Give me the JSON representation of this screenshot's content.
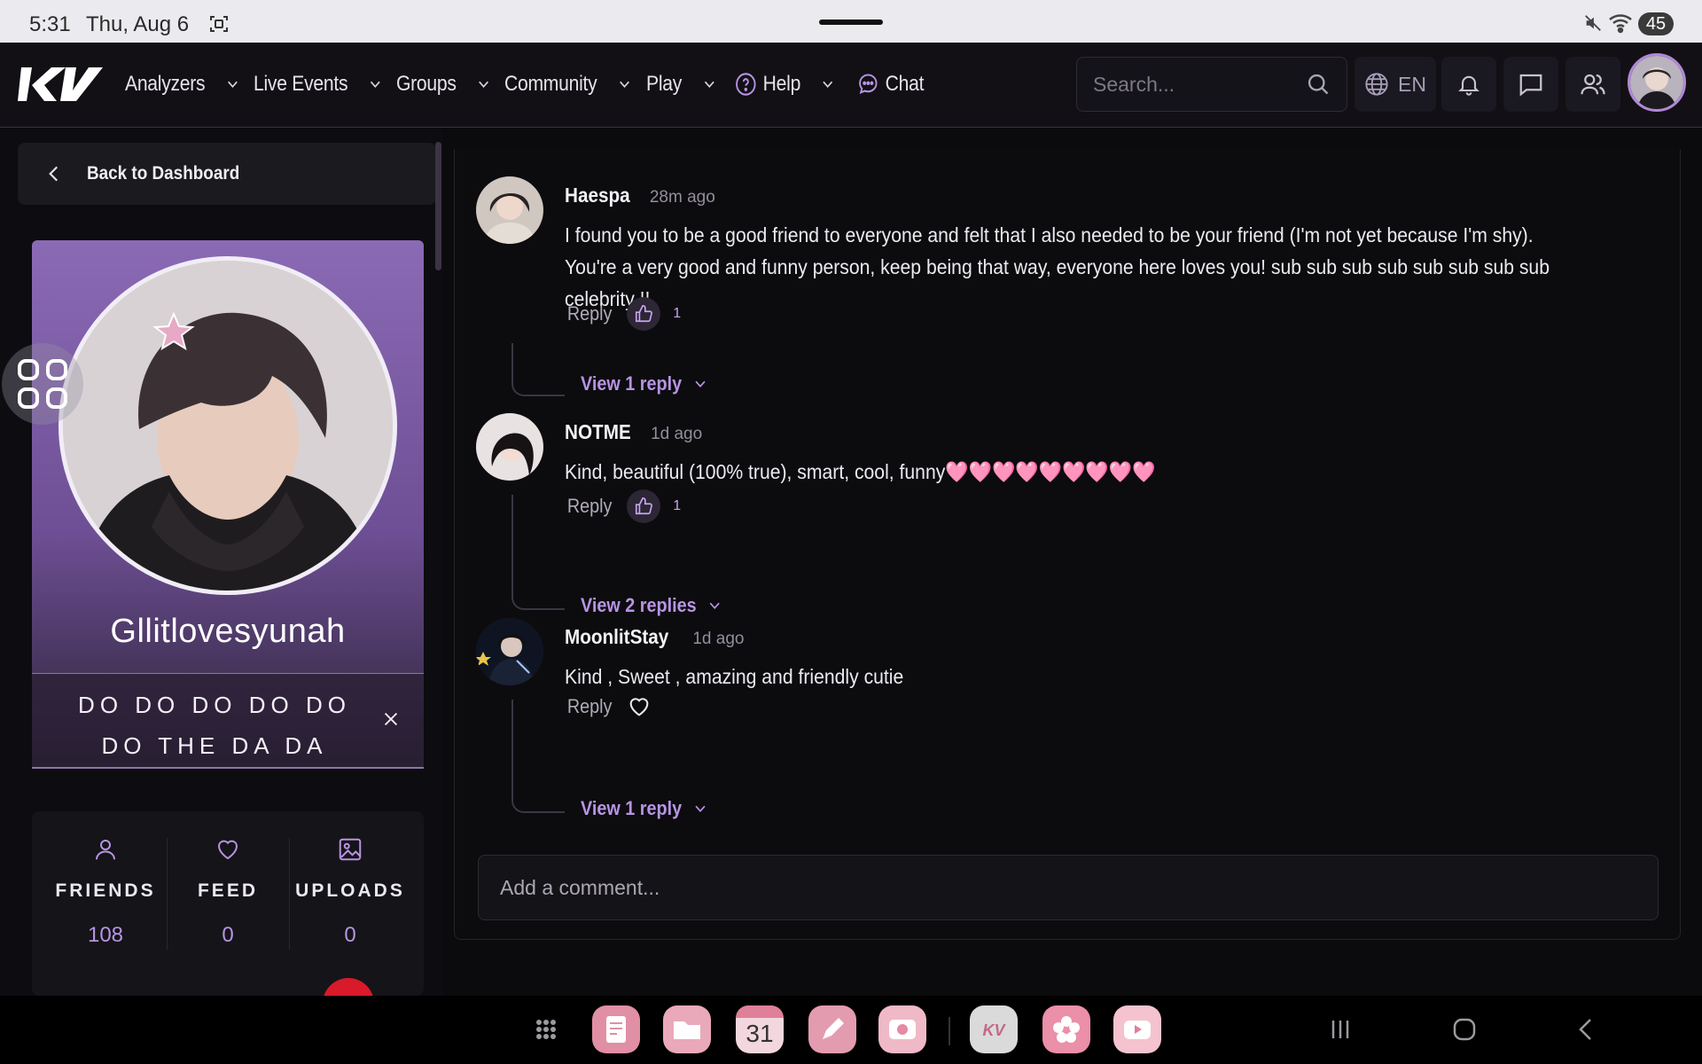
{
  "status_bar": {
    "time": "5:31",
    "date": "Thu, Aug 6",
    "battery": "45"
  },
  "nav": {
    "items": [
      {
        "label": "Analyzers"
      },
      {
        "label": "Live Events"
      },
      {
        "label": "Groups"
      },
      {
        "label": "Community"
      },
      {
        "label": "Play"
      },
      {
        "label": "Help"
      },
      {
        "label": "Chat"
      }
    ],
    "search_placeholder": "Search...",
    "language": "EN"
  },
  "sidebar": {
    "back_label": "Back to Dashboard",
    "profile_name": "Gllitlovesyunah",
    "status_text": "DO DO DO DO DO DO THE DA DA",
    "stats": [
      {
        "label": "FRIENDS",
        "value": "108",
        "icon": "person-icon"
      },
      {
        "label": "FEED",
        "value": "0",
        "icon": "heart-icon"
      },
      {
        "label": "UPLOADS",
        "value": "0",
        "icon": "image-icon"
      }
    ]
  },
  "comments": [
    {
      "author": "Haespa",
      "time": "28m ago",
      "text": "I found you to be a good friend to everyone and felt that I also needed to be your friend (I'm not yet because I'm shy). You're a very good and funny person, keep being that way, everyone here loves you! sub sub sub sub sub sub sub sub celebrity !!",
      "reply_label": "Reply",
      "likes": "1",
      "view_replies": "View 1 reply"
    },
    {
      "author": "NOTME",
      "time": "1d ago",
      "text": "Kind, beautiful (100% true), smart, cool, funny🩷🩷🩷🩷🩷🩷🩷🩷🩷",
      "reply_label": "Reply",
      "likes": "1",
      "view_replies": "View 2 replies"
    },
    {
      "author": "MoonlitStay",
      "time": "1d ago",
      "text": "Kind , Sweet , amazing and friendly cutie",
      "reply_label": "Reply",
      "likes": "",
      "view_replies": "View 1 reply"
    }
  ],
  "add_comment_placeholder": "Add a comment...",
  "colors": {
    "accent": "#b794e3",
    "profile_gradient_top": "#8b6ab5",
    "background": "#0b0a0d"
  },
  "dock": {
    "calendar_day": "31",
    "apps": [
      "notes-app",
      "files-app",
      "calendar-app",
      "pen-app",
      "camera-app",
      "kv-app",
      "flower-app",
      "youtube-app"
    ]
  }
}
